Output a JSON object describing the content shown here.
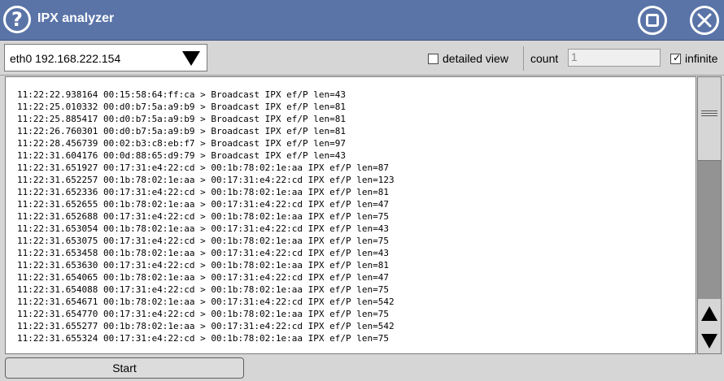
{
  "app": {
    "title": "IPX analyzer",
    "help_glyph": "?"
  },
  "colors": {
    "titlebar": "#5a74a8",
    "track": "#939393"
  },
  "icons": {
    "help": "help-circle-icon",
    "maximize": "maximize-icon",
    "close": "close-circle-icon"
  },
  "toolbar": {
    "interface": "eth0 192.168.222.154",
    "detailed_label": "detailed view",
    "detailed_checked": false,
    "count_label": "count",
    "count_value": "1",
    "infinite_label": "infinite",
    "infinite_checked": true
  },
  "log": [
    "11:22:22.938164 00:15:58:64:ff:ca > Broadcast IPX ef/P len=43",
    "11:22:25.010332 00:d0:b7:5a:a9:b9 > Broadcast IPX ef/P len=81",
    "11:22:25.885417 00:d0:b7:5a:a9:b9 > Broadcast IPX ef/P len=81",
    "11:22:26.760301 00:d0:b7:5a:a9:b9 > Broadcast IPX ef/P len=81",
    "11:22:28.456739 00:02:b3:c8:eb:f7 > Broadcast IPX ef/P len=97",
    "11:22:31.604176 00:0d:88:65:d9:79 > Broadcast IPX ef/P len=43",
    "11:22:31.651927 00:17:31:e4:22:cd > 00:1b:78:02:1e:aa IPX ef/P len=87",
    "11:22:31.652257 00:1b:78:02:1e:aa > 00:17:31:e4:22:cd IPX ef/P len=123",
    "11:22:31.652336 00:17:31:e4:22:cd > 00:1b:78:02:1e:aa IPX ef/P len=81",
    "11:22:31.652655 00:1b:78:02:1e:aa > 00:17:31:e4:22:cd IPX ef/P len=47",
    "11:22:31.652688 00:17:31:e4:22:cd > 00:1b:78:02:1e:aa IPX ef/P len=75",
    "11:22:31.653054 00:1b:78:02:1e:aa > 00:17:31:e4:22:cd IPX ef/P len=43",
    "11:22:31.653075 00:17:31:e4:22:cd > 00:1b:78:02:1e:aa IPX ef/P len=75",
    "11:22:31.653458 00:1b:78:02:1e:aa > 00:17:31:e4:22:cd IPX ef/P len=43",
    "11:22:31.653630 00:17:31:e4:22:cd > 00:1b:78:02:1e:aa IPX ef/P len=81",
    "11:22:31.654065 00:1b:78:02:1e:aa > 00:17:31:e4:22:cd IPX ef/P len=47",
    "11:22:31.654088 00:17:31:e4:22:cd > 00:1b:78:02:1e:aa IPX ef/P len=75",
    "11:22:31.654671 00:1b:78:02:1e:aa > 00:17:31:e4:22:cd IPX ef/P len=542",
    "11:22:31.654770 00:17:31:e4:22:cd > 00:1b:78:02:1e:aa IPX ef/P len=75",
    "11:22:31.655277 00:1b:78:02:1e:aa > 00:17:31:e4:22:cd IPX ef/P len=542",
    "11:22:31.655324 00:17:31:e4:22:cd > 00:1b:78:02:1e:aa IPX ef/P len=75"
  ],
  "actions": {
    "start": "Start"
  }
}
